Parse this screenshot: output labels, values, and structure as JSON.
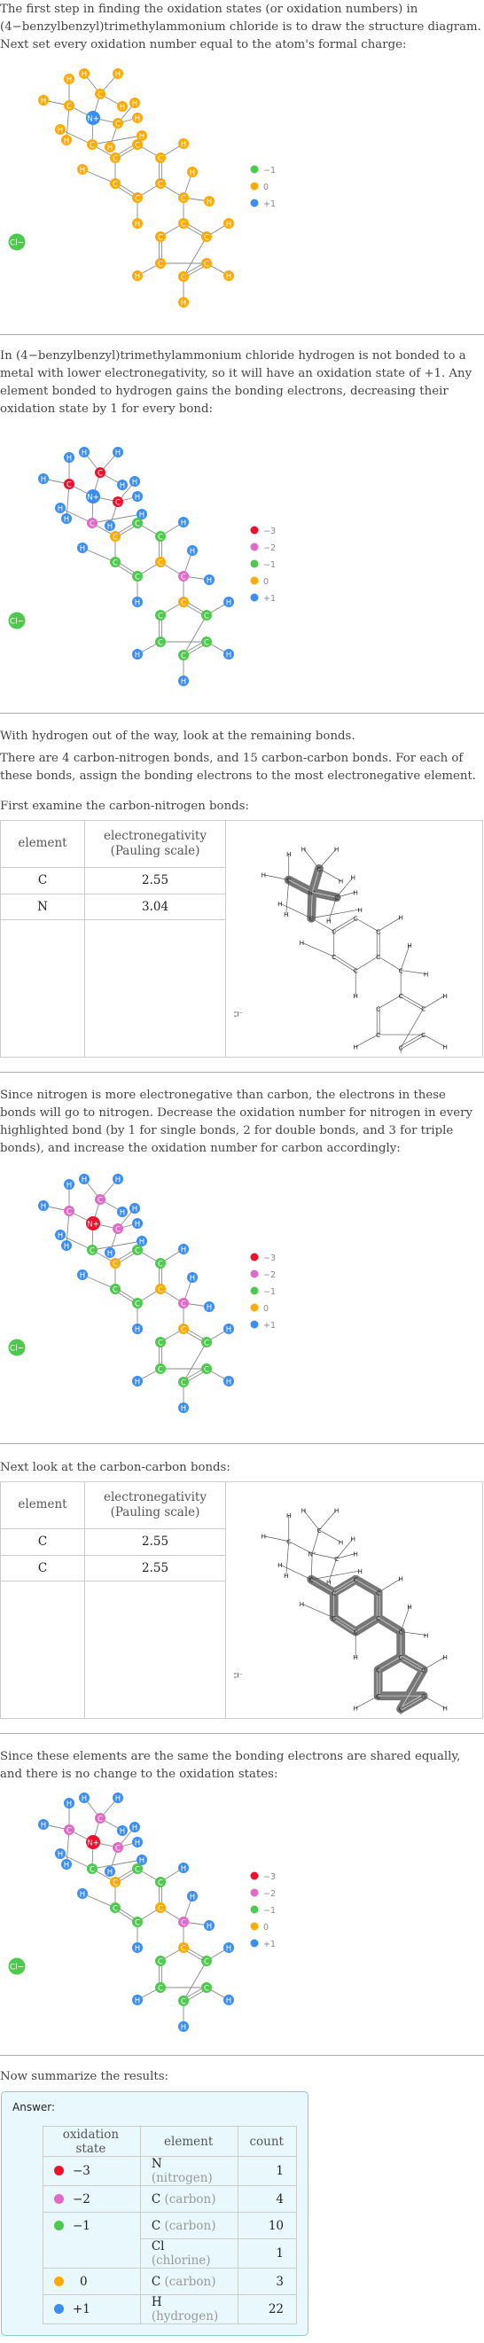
{
  "intro": {
    "text": "The first step in finding the oxidation states (or oxidation numbers) in (4−benzylbenzyl)trimethylammonium chloride is to draw the structure diagram. Next set every oxidation number equal to the atom's formal charge:"
  },
  "colors": {
    "-3": "#f0102b",
    "-2": "#e06ac8",
    "-1": "#4dc94d",
    "0": "#ffaa00",
    "+1": "#3b8ef0"
  },
  "legends": {
    "initial": [
      "-1",
      "0",
      "+1"
    ],
    "full": [
      "-3",
      "-2",
      "-1",
      "0",
      "+1"
    ]
  },
  "legend_labels": {
    "-3": "−3",
    "-2": "−2",
    "-1": "−1",
    "0": "0",
    "+1": "+1"
  },
  "molecule": {
    "atoms": [
      {
        "id": 0,
        "el": "H"
      },
      {
        "id": 1,
        "el": "H"
      },
      {
        "id": 2,
        "el": "H"
      },
      {
        "id": 3,
        "el": "C"
      },
      {
        "id": 4,
        "el": "H"
      },
      {
        "id": 5,
        "el": "C"
      },
      {
        "id": 6,
        "el": "H"
      },
      {
        "id": 7,
        "el": "H"
      },
      {
        "id": 8,
        "el": "N",
        "label": "N+"
      },
      {
        "id": 9,
        "el": "C"
      },
      {
        "id": 10,
        "el": "H"
      },
      {
        "id": 11,
        "el": "H"
      },
      {
        "id": 12,
        "el": "H"
      },
      {
        "id": 13,
        "el": "C"
      },
      {
        "id": 14,
        "el": "H"
      },
      {
        "id": 15,
        "el": "H"
      },
      {
        "id": 16,
        "el": "C"
      },
      {
        "id": 17,
        "el": "H"
      },
      {
        "id": 18,
        "el": "C"
      },
      {
        "id": 19,
        "el": "C"
      },
      {
        "id": 20,
        "el": "H"
      },
      {
        "id": 21,
        "el": "C"
      },
      {
        "id": 22,
        "el": "C"
      },
      {
        "id": 23,
        "el": "H"
      },
      {
        "id": 24,
        "el": "C"
      },
      {
        "id": 25,
        "el": "C"
      },
      {
        "id": 26,
        "el": "H"
      },
      {
        "id": 27,
        "el": "H"
      },
      {
        "id": 28,
        "el": "C"
      },
      {
        "id": 29,
        "el": "H"
      },
      {
        "id": 30,
        "el": "C"
      },
      {
        "id": 31,
        "el": "C"
      },
      {
        "id": 32,
        "el": "C"
      },
      {
        "id": 33,
        "el": "C"
      },
      {
        "id": 34,
        "el": "H"
      },
      {
        "id": 35,
        "el": "C"
      },
      {
        "id": 36,
        "el": "H"
      },
      {
        "id": 37,
        "el": "H"
      },
      {
        "id": 38,
        "el": "Cl",
        "label": "Cl−"
      }
    ],
    "bonds": [
      [
        5,
        0
      ],
      [
        5,
        4
      ],
      [
        5,
        12
      ],
      [
        5,
        8
      ],
      [
        3,
        1
      ],
      [
        3,
        2
      ],
      [
        3,
        6
      ],
      [
        3,
        8
      ],
      [
        8,
        9
      ],
      [
        9,
        7
      ],
      [
        9,
        10
      ],
      [
        9,
        15
      ],
      [
        8,
        13
      ],
      [
        13,
        11
      ],
      [
        13,
        14
      ],
      [
        13,
        18
      ],
      [
        18,
        16,
        2
      ],
      [
        16,
        19
      ],
      [
        19,
        17
      ],
      [
        19,
        22,
        2
      ],
      [
        18,
        21
      ],
      [
        21,
        20
      ],
      [
        21,
        24,
        2
      ],
      [
        24,
        22
      ],
      [
        24,
        27
      ],
      [
        22,
        25
      ],
      [
        25,
        23
      ],
      [
        25,
        26
      ],
      [
        25,
        28
      ],
      [
        28,
        31,
        2
      ],
      [
        28,
        30
      ],
      [
        31,
        29
      ],
      [
        30,
        32,
        2
      ],
      [
        32,
        33
      ],
      [
        33,
        35,
        2
      ],
      [
        35,
        31
      ],
      [
        32,
        34
      ],
      [
        33,
        36
      ],
      [
        35,
        37
      ]
    ],
    "states": {
      "initial": [
        "0",
        "0",
        "0",
        "0",
        "0",
        "0",
        "0",
        "0",
        "+1",
        "0",
        "0",
        "0",
        "0",
        "0",
        "0",
        "0",
        "0",
        "0",
        "0",
        "0",
        "0",
        "0",
        "0",
        "0",
        "0",
        "0",
        "0",
        "0",
        "0",
        "0",
        "0",
        "0",
        "0",
        "0",
        "0",
        "0",
        "0",
        "0",
        "-1"
      ],
      "after_h": [
        "+1",
        "+1",
        "+1",
        "-3",
        "+1",
        "-3",
        "+1",
        "+1",
        "+1",
        "-3",
        "+1",
        "+1",
        "+1",
        "-2",
        "+1",
        "+1",
        "-1",
        "+1",
        "0",
        "-1",
        "+1",
        "-1",
        "0",
        "+1",
        "-1",
        "-2",
        "+1",
        "+1",
        "0",
        "+1",
        "-1",
        "-1",
        "-1",
        "-1",
        "+1",
        "-1",
        "+1",
        "+1",
        "-1"
      ],
      "after_cn": [
        "+1",
        "+1",
        "+1",
        "-2",
        "+1",
        "-2",
        "+1",
        "+1",
        "-3",
        "-2",
        "+1",
        "+1",
        "+1",
        "-1",
        "+1",
        "+1",
        "-1",
        "+1",
        "0",
        "-1",
        "+1",
        "-1",
        "0",
        "+1",
        "-1",
        "-2",
        "+1",
        "+1",
        "0",
        "+1",
        "-1",
        "-1",
        "-1",
        "-1",
        "+1",
        "-1",
        "+1",
        "+1",
        "-1"
      ]
    }
  },
  "section2": {
    "text": "In (4−benzylbenzyl)trimethylammonium chloride hydrogen is not bonded to a metal with lower electronegativity, so it will have an oxidation state of +1. Any element bonded to hydrogen gains the bonding electrons, decreasing their oxidation state by 1 for every bond:"
  },
  "section3": {
    "line1": "With hydrogen out of the way, look at the remaining bonds.",
    "line2": "There are 4 carbon-nitrogen bonds, and 15 carbon-carbon bonds.  For each of these bonds, assign the bonding electrons to the most electronegative element.",
    "line3": "First examine the carbon-nitrogen bonds:",
    "table": {
      "headers": [
        "element",
        "electronegativity\n(Pauling scale)"
      ],
      "rows": [
        [
          "C",
          "2.55"
        ],
        [
          "N",
          "3.04"
        ]
      ]
    }
  },
  "section4": {
    "text": "Since nitrogen is more electronegative than carbon, the electrons in these bonds will go to nitrogen. Decrease the oxidation number for nitrogen in every highlighted bond (by 1 for single bonds, 2 for double bonds, and 3 for triple bonds), and increase the oxidation number for carbon accordingly:"
  },
  "section5": {
    "line1": "Next look at the carbon-carbon bonds:",
    "table": {
      "headers": [
        "element",
        "electronegativity\n(Pauling scale)"
      ],
      "rows": [
        [
          "C",
          "2.55"
        ],
        [
          "C",
          "2.55"
        ]
      ]
    }
  },
  "section6": {
    "text": "Since these elements are the same the bonding electrons are shared equally, and there is no change to the oxidation states:"
  },
  "summary": {
    "intro": "Now summarize the results:",
    "answer_label": "Answer:",
    "headers": [
      "oxidation state",
      "element",
      "count"
    ],
    "rows": [
      {
        "state": "-3",
        "state_label": "−3",
        "symbol": "N",
        "name": "(nitrogen)",
        "count": "1"
      },
      {
        "state": "-2",
        "state_label": "−2",
        "symbol": "C",
        "name": "(carbon)",
        "count": "4"
      },
      {
        "state": "-1",
        "state_label": "−1",
        "symbol": "C",
        "name": "(carbon)",
        "count": "10"
      },
      {
        "state": "",
        "state_label": "",
        "symbol": "Cl",
        "name": "(chlorine)",
        "count": "1"
      },
      {
        "state": "0",
        "state_label": "0",
        "symbol": "C",
        "name": "(carbon)",
        "count": "3"
      },
      {
        "state": "+1",
        "state_label": "+1",
        "symbol": "H",
        "name": "(hydrogen)",
        "count": "22"
      }
    ]
  }
}
